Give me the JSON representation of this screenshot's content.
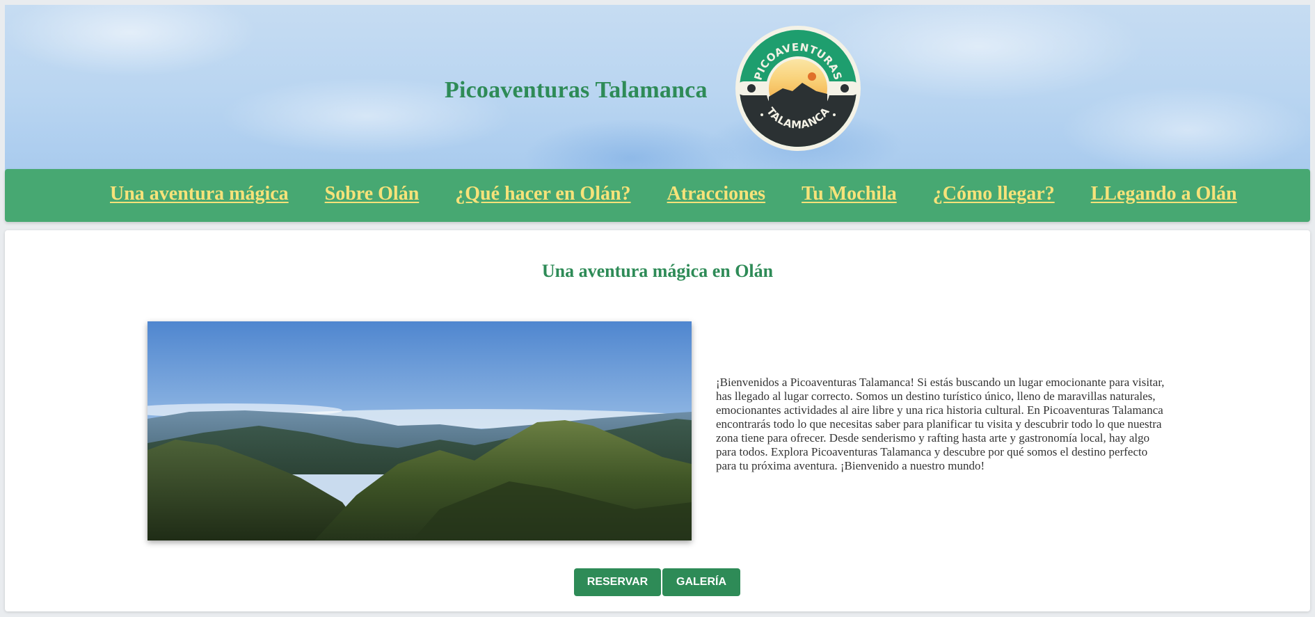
{
  "header": {
    "site_title": "Picoaventuras Talamanca",
    "logo": {
      "top_text": "PICOAVENTURAS",
      "bottom_text": "TALAMANCA"
    }
  },
  "nav": {
    "items": [
      {
        "label": "Una aventura mágica"
      },
      {
        "label": "Sobre Olán"
      },
      {
        "label": "¿Qué hacer en Olán?"
      },
      {
        "label": "Atracciones"
      },
      {
        "label": "Tu Mochila"
      },
      {
        "label": "¿Cómo llegar?"
      },
      {
        "label": "LLegando a Olán"
      }
    ]
  },
  "main": {
    "title": "Una aventura mágica en Olán",
    "intro": "¡Bienvenidos a Picoaventuras Talamanca! Si estás buscando un lugar emocionante para visitar, has llegado al lugar correcto. Somos un destino turístico único, lleno de maravillas naturales, emocionantes actividades al aire libre y una rica historia cultural. En Picoaventuras Talamanca encontrarás todo lo que necesitas saber para planificar tu visita y descubrir todo lo que nuestra zona tiene para ofrecer. Desde senderismo y rafting hasta arte y gastronomía local, hay algo para todos. Explora Picoaventuras Talamanca y descubre por qué somos el destino perfecto para tu próxima aventura. ¡Bienvenido a nuestro mundo!",
    "buttons": {
      "reservar": "RESERVAR",
      "galeria": "GALERÍA"
    }
  },
  "colors": {
    "brand_green": "#2e8b57",
    "nav_green": "#47a872",
    "nav_link": "#f6e27a",
    "sky": "#b9d5f1"
  }
}
